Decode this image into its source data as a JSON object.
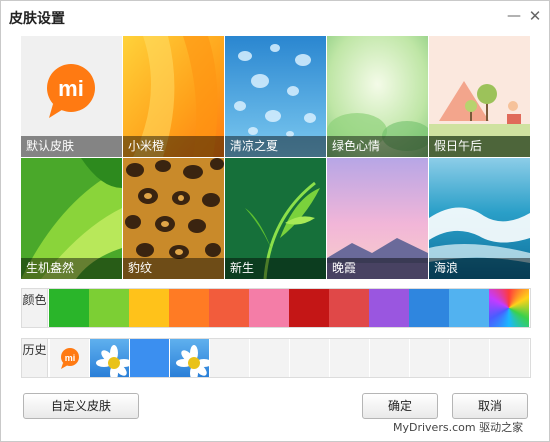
{
  "window": {
    "title": "皮肤设置",
    "minimize_glyph": "—",
    "close_glyph": "✕"
  },
  "skins": [
    {
      "label": "默认皮肤",
      "icon": "mi-chat-bubble-icon"
    },
    {
      "label": "小米橙"
    },
    {
      "label": "清凉之夏"
    },
    {
      "label": "绿色心情"
    },
    {
      "label": "假日午后"
    },
    {
      "label": "生机盎然"
    },
    {
      "label": "豹纹"
    },
    {
      "label": "新生"
    },
    {
      "label": "晚霞"
    },
    {
      "label": "海浪"
    }
  ],
  "colors": {
    "title": "颜色",
    "swatches": [
      "#2ab52a",
      "#7ccf34",
      "#ffc21a",
      "#ff7b24",
      "#f25c3c",
      "#f47da7",
      "#c41616",
      "#e04848",
      "#9a56e0",
      "#2f86df",
      "#52b2f0",
      "rainbow"
    ]
  },
  "history": {
    "title": "历史",
    "items": [
      "mi-logo",
      "daisy",
      "blue",
      "daisy",
      "",
      "",
      "",
      "",
      "",
      "",
      "",
      ""
    ],
    "mi_text": "mi"
  },
  "buttons": {
    "custom": "自定义皮肤",
    "ok": "确定",
    "cancel": "取消"
  },
  "tile_icon_text": "mi",
  "watermark": "MyDrivers.com 驱动之家"
}
